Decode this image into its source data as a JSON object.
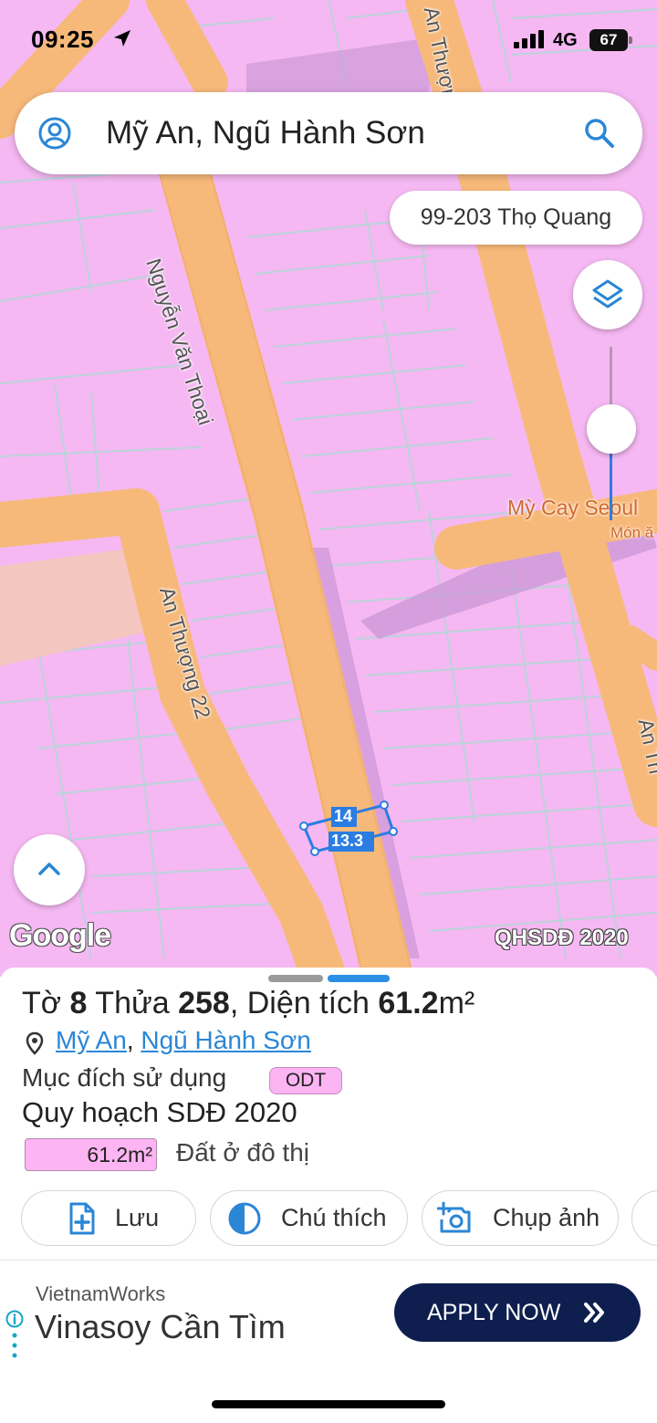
{
  "status_bar": {
    "time": "09:25",
    "network": "4G",
    "battery": "67"
  },
  "search": {
    "title": "Mỹ An, Ngũ Hành Sơn"
  },
  "address_chip": "99-203 Thọ Quang",
  "map": {
    "streets": [
      "Nguyễn Văn Thoại",
      "An Thượng 22",
      "An Thượng",
      "An Th"
    ],
    "poi": {
      "name": "Mỳ Cay Seoul",
      "sub": "Món ă"
    },
    "parcel_labels": [
      "14",
      "13.3"
    ],
    "watermark": "Google",
    "plan_label": "QHSDĐ 2020"
  },
  "sheet": {
    "sheet_label": "Tờ",
    "sheet_no": "8",
    "parcel_label": "Thửa",
    "parcel_no": "258",
    "area_label": "Diện tích",
    "area_value": "61.2",
    "area_unit": "m²",
    "location": {
      "ward": "Mỹ An",
      "district": "Ngũ Hành Sơn"
    },
    "purpose_label": "Mục đích sử dụng",
    "purpose_code": "ODT",
    "planning_title": "Quy hoạch SDĐ 2020",
    "plan_area": "61.2m²",
    "land_use": "Đất ở đô thị"
  },
  "actions": {
    "save": "Lưu",
    "legend": "Chú thích",
    "photo": "Chụp ảnh"
  },
  "ad": {
    "brand": "VietnamWorks",
    "headline": "Vinasoy Cần Tìm",
    "cta": "APPLY NOW"
  },
  "colors": {
    "residential": "#f5b8f2",
    "road": "#f7b97a",
    "accent": "#2b86d6",
    "cta": "#0e1f4f"
  }
}
